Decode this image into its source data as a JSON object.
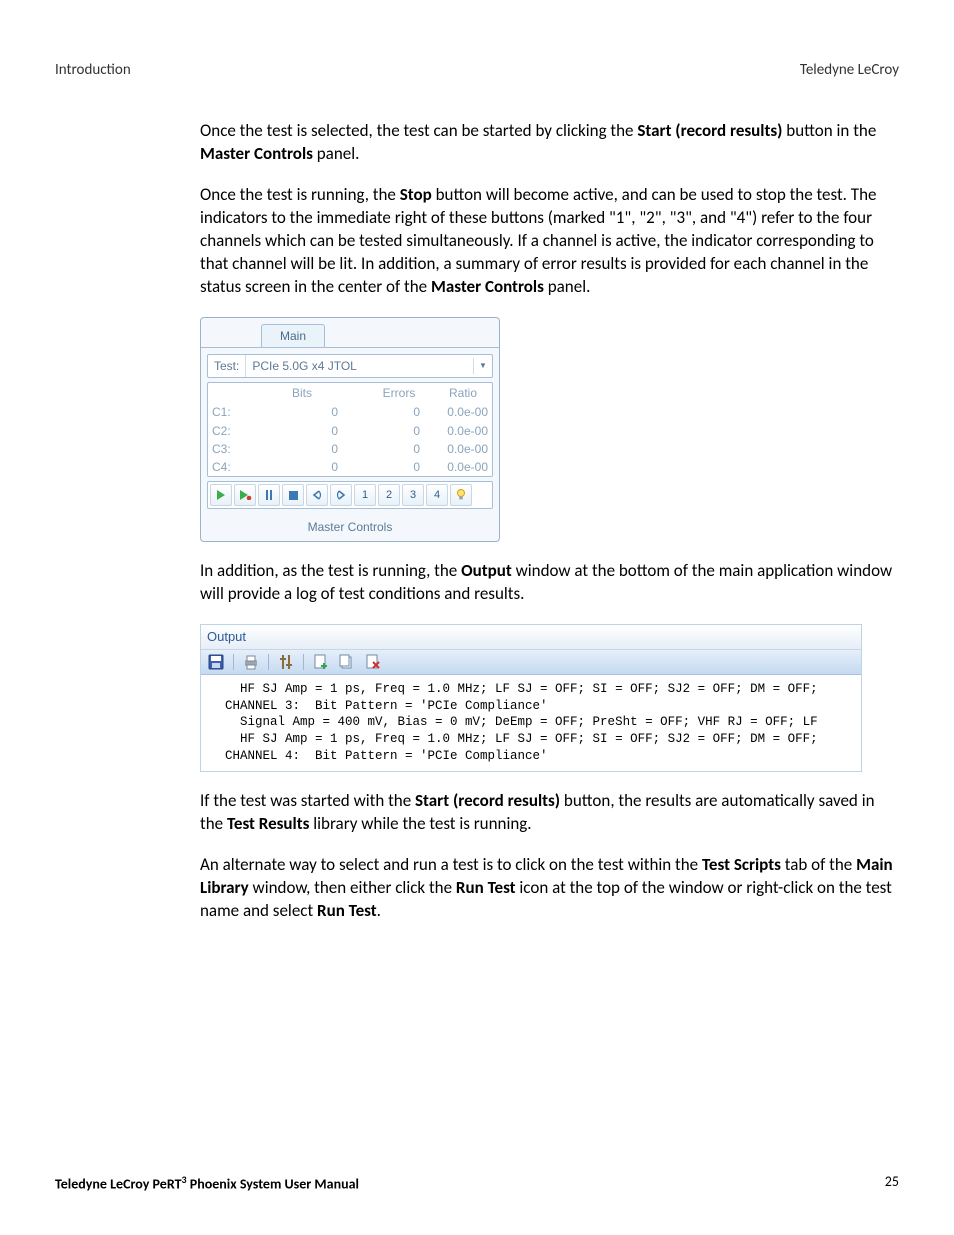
{
  "header": {
    "left": "Introduction",
    "right": "Teledyne LeCroy"
  },
  "para1": {
    "a": "Once the test is selected, the test can be started by clicking the ",
    "b": "Start (record results)",
    "c": " button in the ",
    "d": "Master Controls",
    "e": " panel."
  },
  "para2": {
    "a": "Once the test is running, the ",
    "b": "Stop",
    "c": " button will become active, and can be used to stop the test. The indicators to the immediate right of these buttons (marked \"1\", \"2\", \"3\", and \"4\") refer to the four channels which can be tested simultaneously. If a channel is active, the indicator corresponding to that channel will be lit. In addition, a summary of error results is provided for each channel in the status screen in the center of the ",
    "d": "Master Controls",
    "e": " panel."
  },
  "masterControls": {
    "tab": "Main",
    "testLabel": "Test:",
    "testValue": "PCIe 5.0G x4 JTOL",
    "headers": {
      "bits": "Bits",
      "errors": "Errors",
      "ratio": "Ratio"
    },
    "rows": [
      {
        "ch": "C1:",
        "bits": "0",
        "errors": "0",
        "ratio": "0.0e-00"
      },
      {
        "ch": "C2:",
        "bits": "0",
        "errors": "0",
        "ratio": "0.0e-00"
      },
      {
        "ch": "C3:",
        "bits": "0",
        "errors": "0",
        "ratio": "0.0e-00"
      },
      {
        "ch": "C4:",
        "bits": "0",
        "errors": "0",
        "ratio": "0.0e-00"
      }
    ],
    "chBtns": [
      "1",
      "2",
      "3",
      "4"
    ],
    "footer": "Master Controls"
  },
  "para3": {
    "a": "In addition, as the test is running, the ",
    "b": "Output",
    "c": " window at the bottom of the main application window will provide a log of test conditions and results."
  },
  "output": {
    "title": "Output",
    "lines": [
      "  HF SJ Amp = 1 ps, Freq = 1.0 MHz; LF SJ = OFF; SI = OFF; SJ2 = OFF; DM = OFF;",
      "CHANNEL 3:  Bit Pattern = 'PCIe Compliance'",
      "  Signal Amp = 400 mV, Bias = 0 mV; DeEmp = OFF; PreSht = OFF; VHF RJ = OFF; LF",
      "  HF SJ Amp = 1 ps, Freq = 1.0 MHz; LF SJ = OFF; SI = OFF; SJ2 = OFF; DM = OFF;",
      "CHANNEL 4:  Bit Pattern = 'PCIe Compliance'"
    ]
  },
  "para4": {
    "a": "If the test was started with the ",
    "b": "Start (record results)",
    "c": " button, the results are automatically saved in the ",
    "d": "Test Results",
    "e": " library while the test is running."
  },
  "para5": {
    "a": "An alternate way to select and run a test is to click on the test within the ",
    "b": "Test Scripts",
    "c": " tab of the ",
    "d": "Main Library",
    "e": " window, then either click the ",
    "f": "Run Test",
    "g": " icon at the top of the window or right-click on the test name and select ",
    "h": "Run Test",
    "i": "."
  },
  "footer": {
    "title_a": "Teledyne LeCroy PeRT",
    "title_sup": "3",
    "title_b": " Phoenix System User Manual",
    "page": "25"
  }
}
